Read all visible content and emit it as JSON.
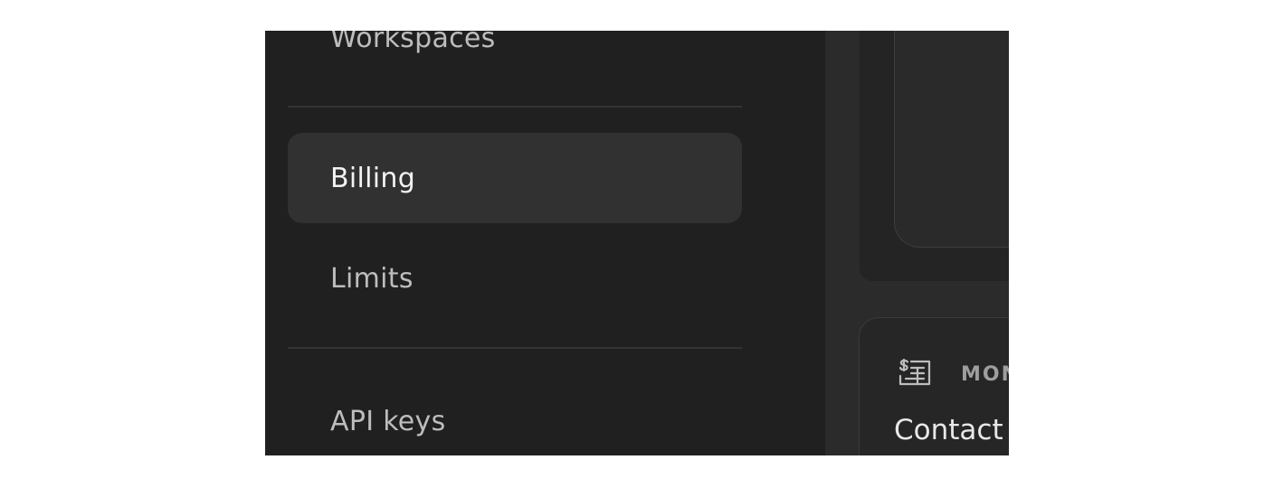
{
  "sidebar": {
    "items": [
      {
        "label": "Workspaces",
        "active": false
      },
      {
        "label": "Billing",
        "active": true
      },
      {
        "label": "Limits",
        "active": false
      },
      {
        "label": "API keys",
        "active": false
      }
    ]
  },
  "main": {
    "card": {
      "icon": "receipt-list-icon",
      "heading": "MON",
      "text": "Contact "
    }
  },
  "colors": {
    "sidebar_bg": "#202020",
    "active_item_bg": "#313131",
    "main_bg": "#2b2b2b",
    "text_primary": "#f2f2f2",
    "text_secondary": "#bdbdbd"
  }
}
